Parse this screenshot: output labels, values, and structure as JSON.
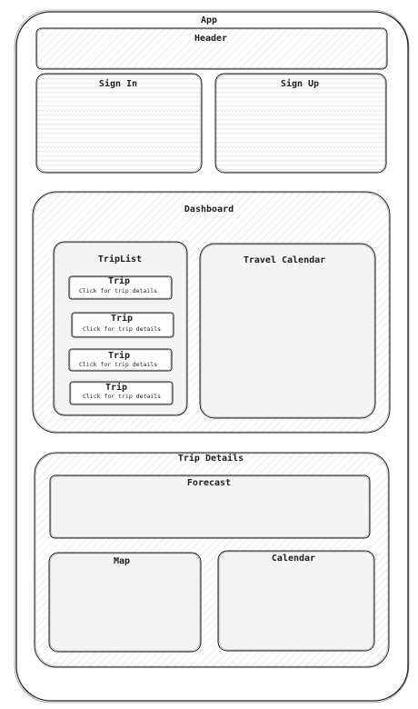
{
  "app": {
    "label": "App"
  },
  "header": {
    "label": "Header"
  },
  "sign_in": {
    "label": "Sign In"
  },
  "sign_up": {
    "label": "Sign Up"
  },
  "dashboard": {
    "label": "Dashboard",
    "trip_list": {
      "label": "TripList",
      "trips": [
        {
          "title": "Trip",
          "hint": "Click for trip details"
        },
        {
          "title": "Trip",
          "hint": "Click for trip details"
        },
        {
          "title": "Trip",
          "hint": "Click for trip details"
        },
        {
          "title": "Trip",
          "hint": "Click for trip details"
        }
      ]
    },
    "travel_calendar": {
      "label": "Travel Calendar"
    }
  },
  "trip_details": {
    "label": "Trip Details",
    "forecast": {
      "label": "Forecast"
    },
    "map": {
      "label": "Map"
    },
    "calendar": {
      "label": "Calendar"
    }
  },
  "colors": {
    "stroke": "#1e1e1e",
    "hatch": "#c9c9c9",
    "fill": "#ffffff"
  }
}
